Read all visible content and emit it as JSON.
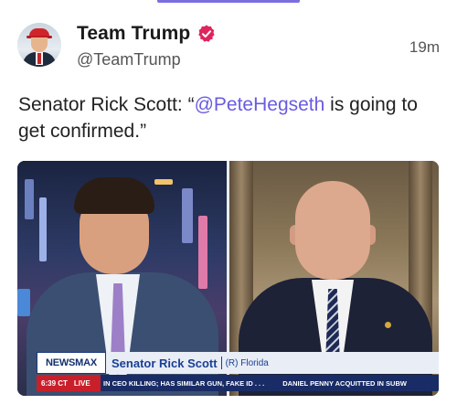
{
  "post": {
    "display_name": "Team Trump",
    "handle": "@TeamTrump",
    "timestamp": "19m",
    "text_prefix": "Senator Rick Scott: “",
    "mention": "@PeteHegseth",
    "text_suffix": " is going to get confirmed.”",
    "verified_color": "#e0245e",
    "mention_color": "#6a5be0"
  },
  "media": {
    "network": "NEWSMAX",
    "guest_name": "Senator Rick Scott",
    "guest_affiliation": "(R) Florida",
    "time": "6:39 CT",
    "live_label": "LIVE",
    "ticker_1": "IN CEO KILLING; HAS SIMILAR GUN, FAKE ID . . .",
    "ticker_2": "DANIEL PENNY ACQUITTED IN SUBW"
  },
  "icons": {
    "verified": "verified-badge-icon",
    "avatar": "profile-avatar"
  }
}
